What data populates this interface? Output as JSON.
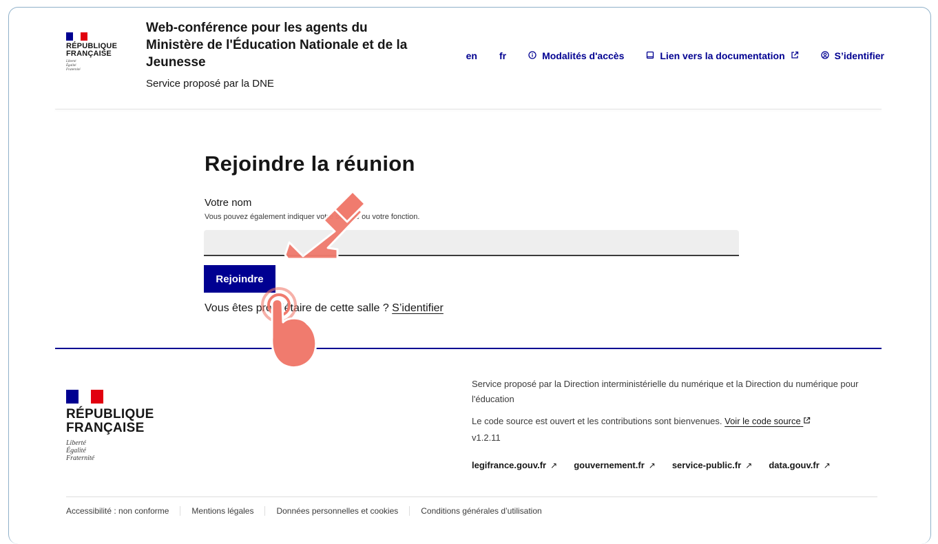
{
  "header": {
    "logo": {
      "line1": "RÉPUBLIQUE",
      "line2": "FRANÇAISE",
      "motto": [
        "Liberté",
        "Égalité",
        "Fraternité"
      ]
    },
    "service_title": "Web-conférence pour les agents du Ministère de l'Éducation Nationale et de la Jeunesse",
    "service_tagline": "Service proposé par la DNE",
    "nav": {
      "lang_en": "en",
      "lang_fr": "fr",
      "access": "Modalités d'accès",
      "docs": "Lien vers la documentation",
      "login": "S’identifier"
    }
  },
  "main": {
    "title": "Rejoindre la réunion",
    "name_label": "Votre nom",
    "name_hint": "Vous pouvez également indiquer votre service ou votre fonction.",
    "name_value": "",
    "join_button": "Rejoindre",
    "owner_text": "Vous êtes propriétaire de cette salle ? ",
    "owner_link": "S’identifier"
  },
  "footer": {
    "logo": {
      "line1": "RÉPUBLIQUE",
      "line2": "FRANÇAISE",
      "motto": [
        "Liberté",
        "Égalité",
        "Fraternité"
      ]
    },
    "desc1": "Service proposé par la Direction interministérielle du numérique et la Direction du numérique pour l'éducation",
    "desc2": "Le code source est ouvert et les contributions sont bienvenues. ",
    "source_link": "Voir le code source",
    "version": "v1.2.11",
    "links": [
      "legifrance.gouv.fr",
      "gouvernement.fr",
      "service-public.fr",
      "data.gouv.fr"
    ],
    "bottom_links": [
      "Accessibilité : non conforme",
      "Mentions légales",
      "Données personnelles et cookies",
      "Conditions générales d’utilisation"
    ]
  },
  "colors": {
    "primary": "#000091",
    "flag_blue": "#000091",
    "flag_red": "#e1000f",
    "overlay_arrow": "#f07b6e"
  },
  "icons": {
    "access": "info-circle-icon",
    "docs": "book-icon",
    "login": "account-circle-icon",
    "external": "external-link-icon",
    "overlay_arrow": "pointer-arrow-icon",
    "overlay_hand": "tap-hand-icon"
  }
}
